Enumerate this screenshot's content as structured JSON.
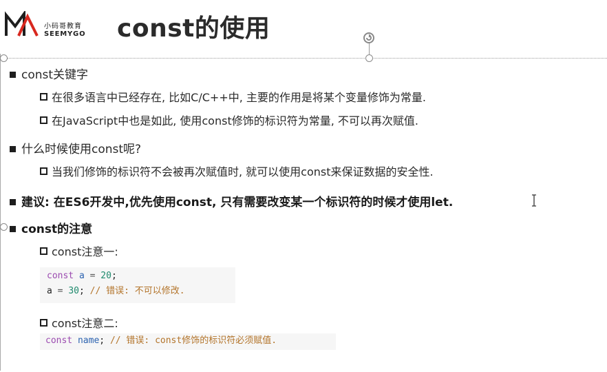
{
  "logo": {
    "text_cn": "小码哥教育",
    "text_en": "SEEMYGO"
  },
  "title": "const的使用",
  "bullets": {
    "b1": {
      "label": "const关键字",
      "subs": [
        "在很多语言中已经存在, 比如C/C++中, 主要的作用是将某个变量修饰为常量.",
        "在JavaScript中也是如此, 使用const修饰的标识符为常量, 不可以再次赋值."
      ]
    },
    "b2": {
      "label": "什么时候使用const呢?",
      "subs": [
        "当我们修饰的标识符不会被再次赋值时, 就可以使用const来保证数据的安全性."
      ]
    },
    "b3": {
      "label": "建议: 在ES6开发中,优先使用const, 只有需要改变某一个标识符的时候才使用let."
    },
    "b4": {
      "label": "const的注意",
      "note1": "const注意一:",
      "note2": "const注意二:"
    }
  },
  "code1": {
    "line1": {
      "kw": "const",
      "id": "a",
      "op": " = ",
      "num": "20",
      "end": ";"
    },
    "line2": {
      "id": "a",
      "op": " = ",
      "num": "30",
      "end": "; ",
      "comment": "// 错误: 不可以修改."
    }
  },
  "code2": {
    "kw": "const",
    "id": "name",
    "end": "; ",
    "comment": "// 错误: const修饰的标识符必须赋值."
  },
  "colors": {
    "keyword": "#9b4bb0",
    "identifier": "#2c63b0",
    "number": "#1f8a6d",
    "comment": "#b3742a",
    "code_bg": "#f6f6f6",
    "logo_red": "#d8281f"
  },
  "icons": [
    "seemygo-logo-icon",
    "rotate-handle-icon",
    "text-cursor-icon"
  ]
}
